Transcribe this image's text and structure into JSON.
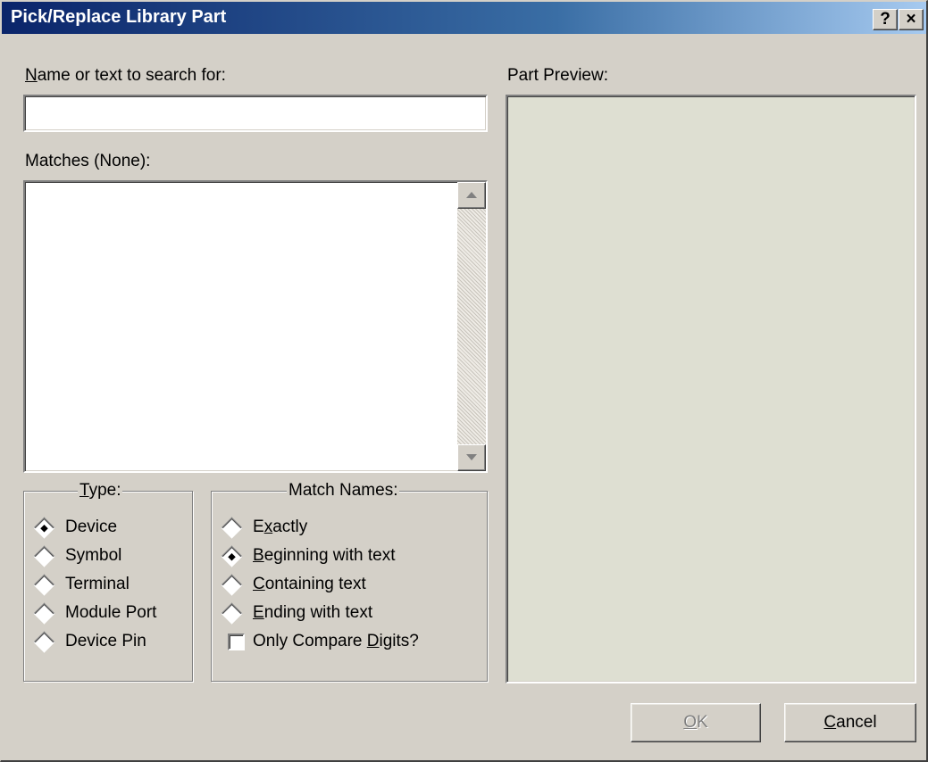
{
  "window": {
    "title": "Pick/Replace Library Part",
    "help_button": "?",
    "close_button": "×"
  },
  "search": {
    "label_accel": "N",
    "label_rest": "ame or text to search for:",
    "value": "",
    "placeholder": ""
  },
  "matches": {
    "label": "Matches (None):",
    "items": []
  },
  "type_group": {
    "legend_accel": "T",
    "legend_rest": "ype:",
    "options": [
      {
        "label": "Device",
        "checked": true
      },
      {
        "label": "Symbol",
        "checked": false
      },
      {
        "label": "Terminal",
        "checked": false
      },
      {
        "label": "Module Port",
        "checked": false
      },
      {
        "label": "Device Pin",
        "checked": false
      }
    ]
  },
  "match_group": {
    "legend": "Match Names:",
    "options": [
      {
        "pre": "E",
        "accel": "x",
        "post": "actly",
        "checked": false
      },
      {
        "pre": "",
        "accel": "B",
        "post": "eginning with text",
        "checked": true
      },
      {
        "pre": "",
        "accel": "C",
        "post": "ontaining text",
        "checked": false
      },
      {
        "pre": "",
        "accel": "E",
        "post": "nding with text",
        "checked": false
      }
    ],
    "digits_checkbox": {
      "pre": "Only Compare ",
      "accel": "D",
      "post": "igits?",
      "checked": false
    }
  },
  "preview": {
    "label": "Part Preview:"
  },
  "buttons": {
    "ok_accel": "O",
    "ok_rest": "K",
    "cancel_accel": "C",
    "cancel_rest": "ancel"
  },
  "colors": {
    "face": "#d4d0c8",
    "title_start": "#0a246a",
    "title_end": "#a6caf0",
    "preview_bg": "#dedfd2"
  }
}
